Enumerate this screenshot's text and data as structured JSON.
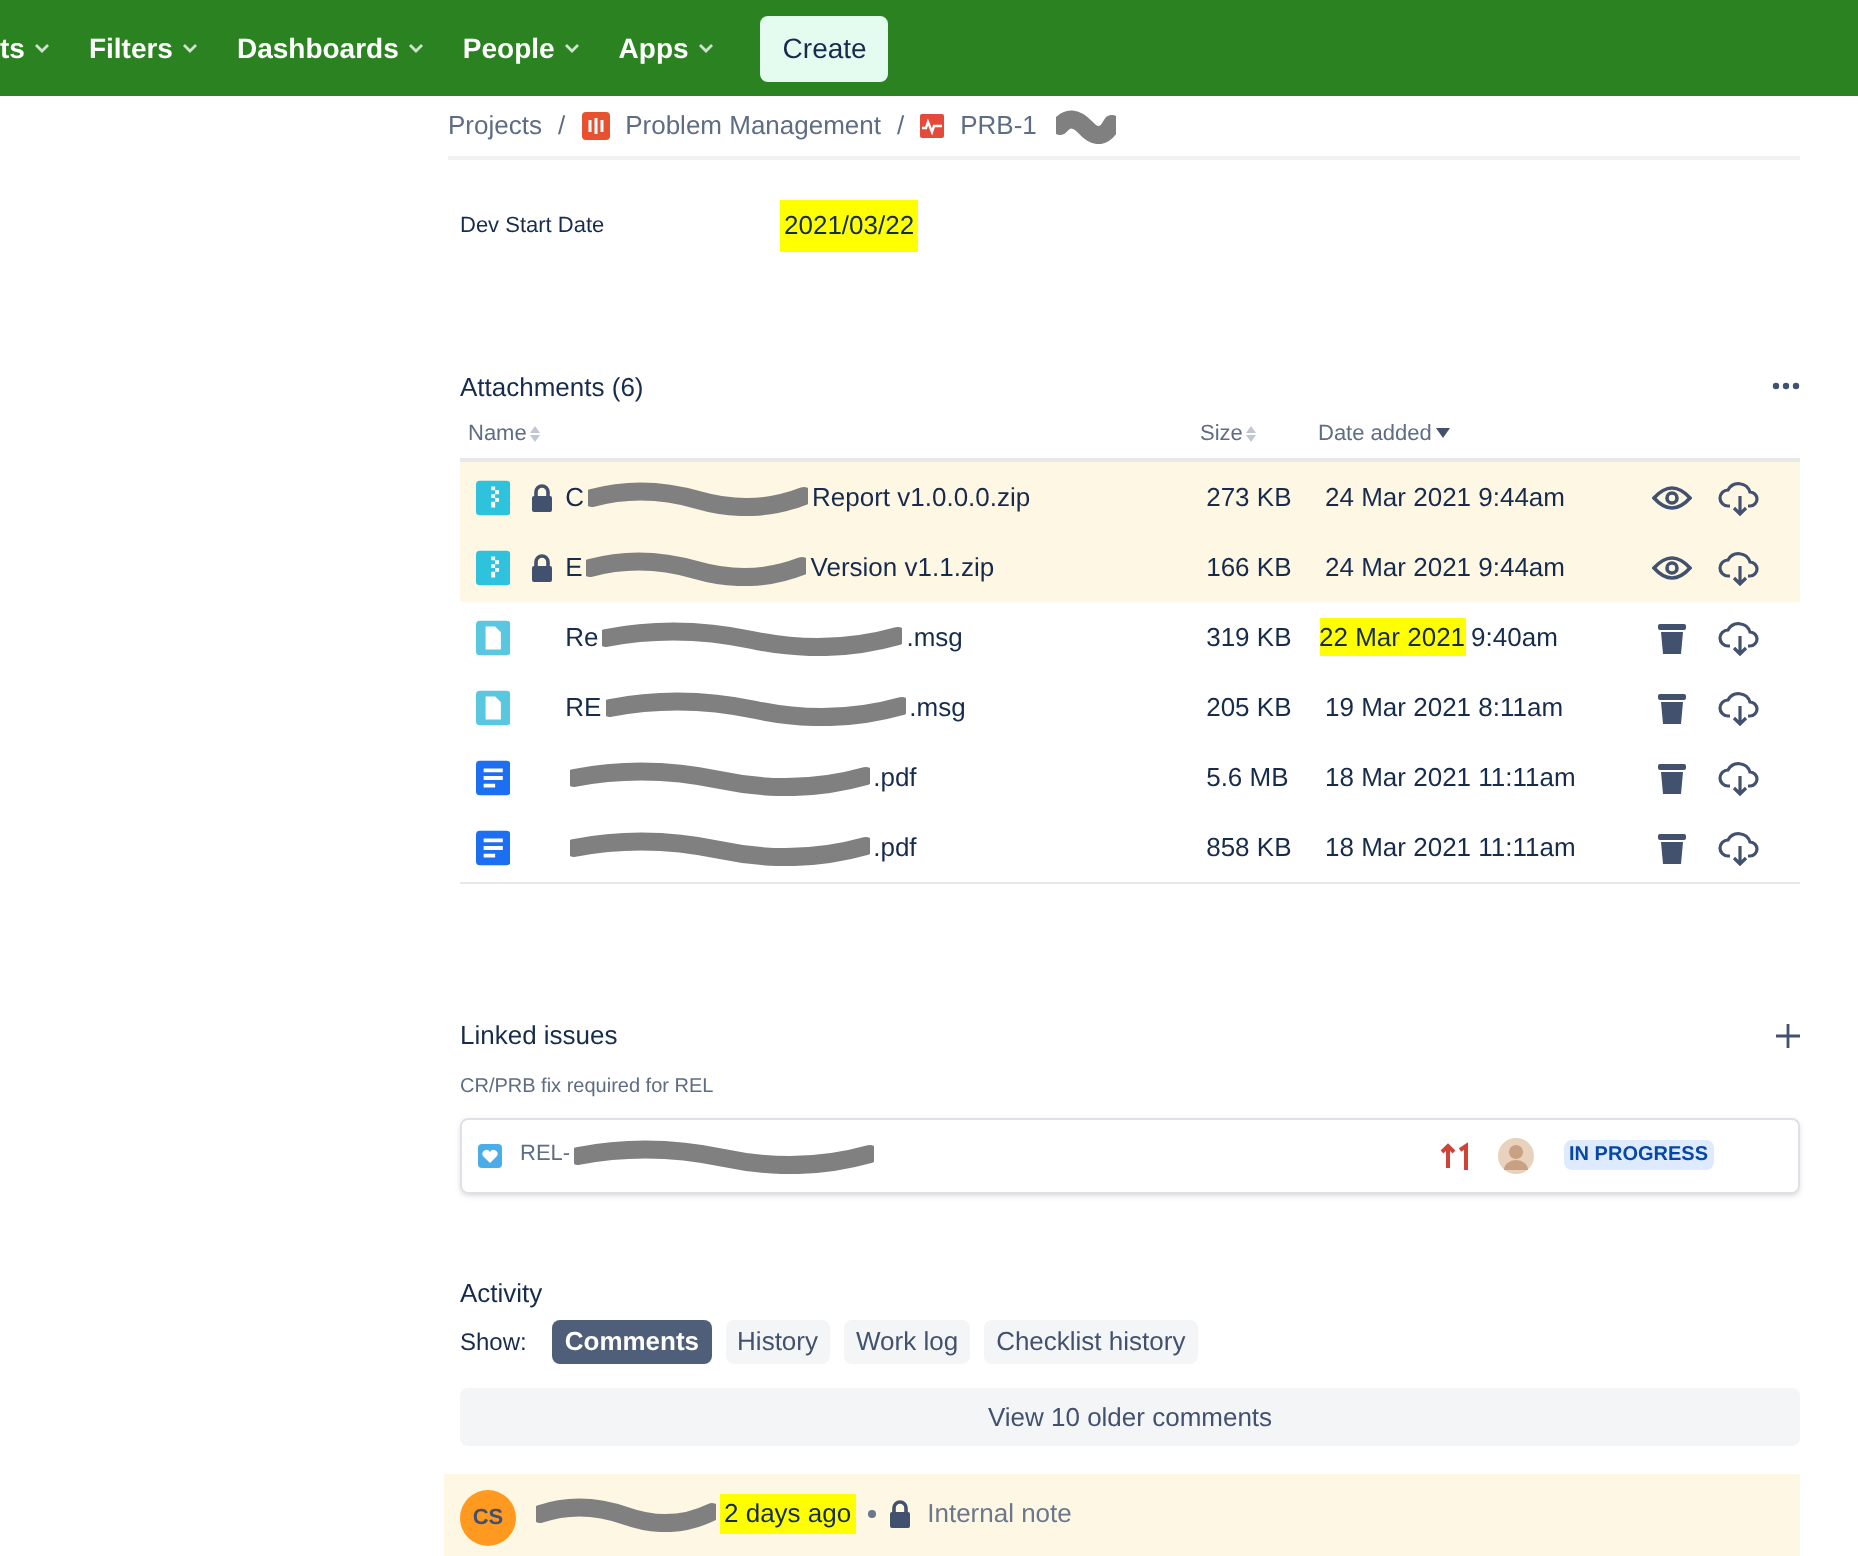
{
  "nav": {
    "items": [
      {
        "label": "ts"
      },
      {
        "label": "Filters"
      },
      {
        "label": "Dashboards"
      },
      {
        "label": "People"
      },
      {
        "label": "Apps"
      }
    ],
    "create": "Create"
  },
  "breadcrumb_separator": "/",
  "breadcrumbs": [
    {
      "label": "Projects",
      "kind": "text"
    },
    {
      "label": "Problem Management",
      "kind": "project"
    },
    {
      "label": "PRB-1",
      "kind": "issue"
    }
  ],
  "field": {
    "label": "Dev Start Date",
    "value": "2021/03/22",
    "highlighted": true
  },
  "attachments": {
    "title": "Attachments (6)",
    "columns": [
      {
        "label": "Name",
        "sorted": false
      },
      {
        "label": "Size",
        "sorted": false
      },
      {
        "label": "Date added",
        "sorted": true
      }
    ],
    "rows": [
      {
        "kind": "zip",
        "locked": true,
        "row_highlighted": true,
        "name_start": "C",
        "name_end": "Report v1.0.0.0.zip",
        "size": "273 KB",
        "date": "24 Mar 2021 9:44am",
        "deletable": false
      },
      {
        "kind": "zip",
        "locked": true,
        "row_highlighted": true,
        "name_start": "E",
        "name_end": "Version v1.1.zip",
        "size": "166 KB",
        "date": "24 Mar 2021 9:44am",
        "deletable": false
      },
      {
        "kind": "msg",
        "locked": false,
        "row_highlighted": false,
        "name_start": "Re",
        "name_end": ".msg",
        "size": "319 KB",
        "date_highlight": "22 Mar 2021",
        "date": "9:40am",
        "deletable": true
      },
      {
        "kind": "msg",
        "locked": false,
        "row_highlighted": false,
        "name_start": "RE",
        "name_end": ".msg",
        "size": "205 KB",
        "date": "19 Mar 2021 8:11am",
        "deletable": true
      },
      {
        "kind": "pdf",
        "locked": false,
        "row_highlighted": false,
        "name_end": ".pdf",
        "size": "5.6 MB",
        "date": "18 Mar 2021 11:11am",
        "deletable": true
      },
      {
        "kind": "pdf",
        "locked": false,
        "row_highlighted": false,
        "name_end": ".pdf",
        "size": "858 KB",
        "date": "18 Mar 2021 11:11am",
        "deletable": true
      }
    ]
  },
  "linked": {
    "title": "Linked issues",
    "relation": "CR/PRB fix required for REL",
    "issue": {
      "key": "REL-",
      "status": "IN PROGRESS"
    }
  },
  "activity": {
    "title": "Activity",
    "show_label": "Show:",
    "tabs": [
      {
        "label": "Comments",
        "selected": true
      },
      {
        "label": "History",
        "selected": false
      },
      {
        "label": "Work log",
        "selected": false
      },
      {
        "label": "Checklist history",
        "selected": false
      }
    ],
    "older": "View 10 older comments",
    "comment": {
      "initials": "CS",
      "time": "2 days ago",
      "visibility": "Internal note"
    }
  }
}
